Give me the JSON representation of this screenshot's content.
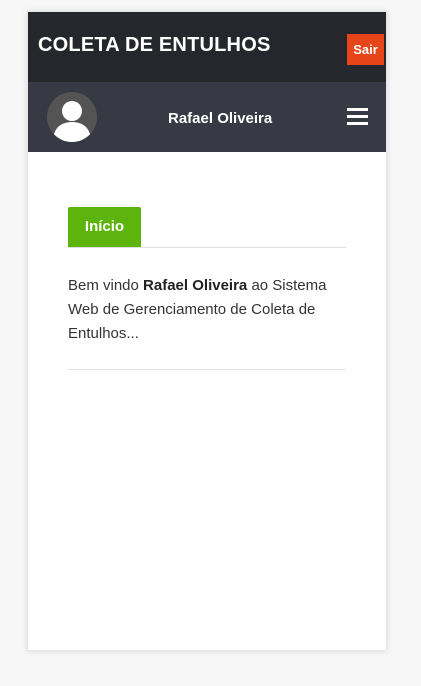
{
  "header": {
    "title": "COLETA DE ENTULHOS",
    "logout_label": "Sair"
  },
  "user": {
    "name": "Rafael Oliveira",
    "avatar_icon": "user-silhouette-icon",
    "menu_icon": "hamburger-menu-icon"
  },
  "tabs": [
    {
      "label": "Início",
      "active": true
    }
  ],
  "welcome": {
    "prefix": "Bem vindo ",
    "name": "Rafael Oliveira",
    "suffix": " ao Sistema Web de Gerenciamento de Coleta de Entulhos..."
  },
  "colors": {
    "topbar": "#25272c",
    "userbar": "#373a44",
    "logout": "#e64419",
    "tab_active": "#5db40c"
  }
}
